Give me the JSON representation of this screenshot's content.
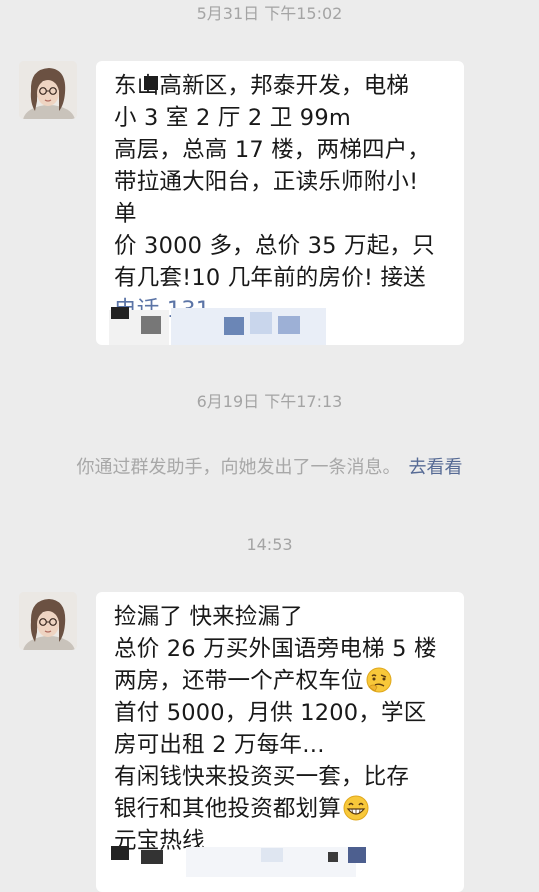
{
  "timestamps": {
    "t1": "5月31日 下午15:02",
    "t2": "6月19日 下午17:13",
    "t3": "14:53"
  },
  "messages": [
    {
      "lines": [
        "东山高新区，邦泰开发，电梯",
        "小 3 室 2 厅 2 卫 99m",
        "高层，总高 17 楼，两梯四户，",
        "带拉通大阳台，正读乐师附小!",
        "单",
        "价 3000 多，总价 35 万起，只",
        "有几套!10 几年前的房价! 接送",
        "电话 131"
      ]
    },
    {
      "lines": [
        "捡漏了  快来捡漏了",
        "总价 26 万买外国语旁电梯 5 楼",
        "两房，还带一个产权车位",
        "首付 5000，月供 1200，学区",
        "房可出租 2 万每年…",
        "有闲钱快来投资买一套，比存",
        "银行和其他投资都划算",
        "元宝热线"
      ],
      "emojis": [
        "thinking-face-emoji",
        "grinning-face-emoji"
      ]
    }
  ],
  "system_notice": {
    "text": "你通过群发助手，向她发出了一条消息。",
    "link": "去看看"
  },
  "colors": {
    "background": "#ececec",
    "bubble": "#ffffff",
    "timestamp": "#a4a4a4",
    "link": "#576b95"
  }
}
